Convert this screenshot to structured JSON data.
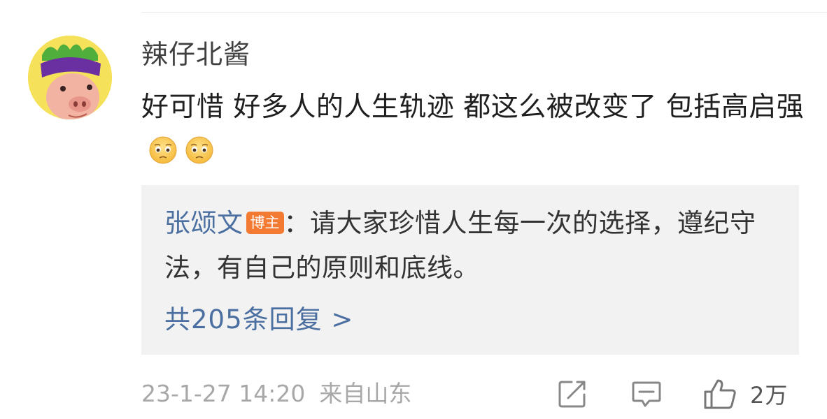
{
  "comment": {
    "username": "辣仔北酱",
    "text": "好可惜 好多人的人生轨迹 都这么被改变了 包括高启强",
    "emoji": "pleading-face",
    "timestamp": "23-1-27 14:20",
    "location": "来自山东"
  },
  "reply": {
    "author": "张颂文",
    "badge": "博主",
    "text": "：请大家珍惜人生每一次的选择，遵纪守法，有自己的原则和底线。",
    "more_link": "共205条回复 >"
  },
  "actions": {
    "like_count": "2万"
  },
  "colors": {
    "reply_author": "#4a6fa0",
    "badge_bg": "#f27a33",
    "reply_bg": "#f2f2f2",
    "meta_text": "#a8a8a8"
  }
}
